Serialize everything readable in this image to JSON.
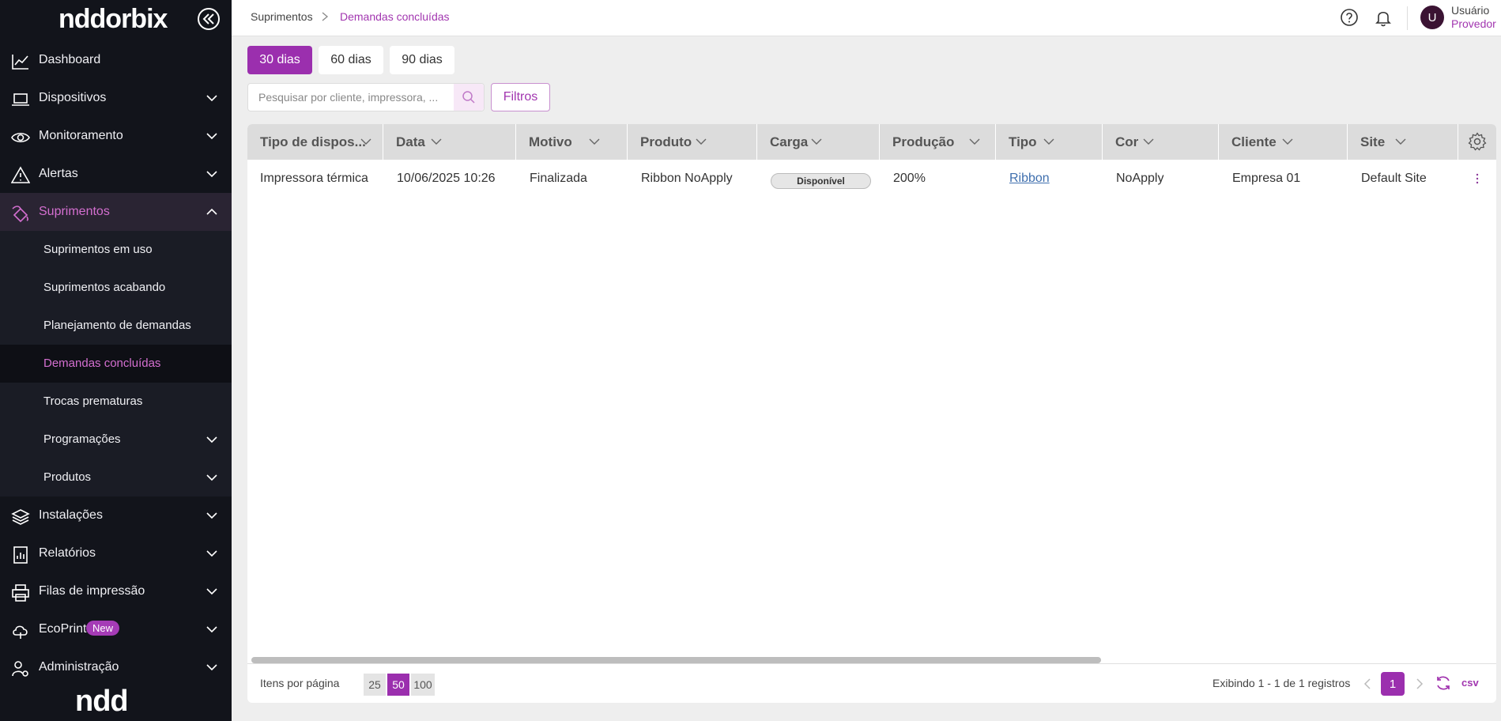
{
  "brand": {
    "name": "nddorbix",
    "footer": "ndd"
  },
  "sidebar": {
    "items": [
      {
        "label": "Dashboard"
      },
      {
        "label": "Dispositivos"
      },
      {
        "label": "Monitoramento"
      },
      {
        "label": "Alertas"
      },
      {
        "label": "Suprimentos"
      },
      {
        "label": "Instalações"
      },
      {
        "label": "Relatórios"
      },
      {
        "label": "Filas de impressão"
      },
      {
        "label": "EcoPrint",
        "badge": "New"
      },
      {
        "label": "Administração"
      }
    ],
    "sub_items": [
      {
        "label": "Suprimentos em uso"
      },
      {
        "label": "Suprimentos acabando"
      },
      {
        "label": "Planejamento de demandas"
      },
      {
        "label": "Demandas concluídas"
      },
      {
        "label": "Trocas prematuras"
      },
      {
        "label": "Programações"
      },
      {
        "label": "Produtos"
      }
    ]
  },
  "breadcrumb": {
    "parent": "Suprimentos",
    "current": "Demandas concluídas"
  },
  "user": {
    "initial": "U",
    "name": "Usuário",
    "role": "Provedor"
  },
  "periods": [
    "30 dias",
    "60 dias",
    "90 dias"
  ],
  "search": {
    "placeholder": "Pesquisar por cliente, impressora, ..."
  },
  "filters_label": "Filtros",
  "table": {
    "columns": [
      "Tipo de dispos...",
      "Data",
      "Motivo",
      "Produto",
      "Carga",
      "Produção",
      "Tipo",
      "Cor",
      "Cliente",
      "Site"
    ],
    "rows": [
      {
        "tipo_dispositivo": "Impressora térmica",
        "data": "10/06/2025 10:26",
        "motivo": "Finalizada",
        "produto": "Ribbon NoApply",
        "carga": "Disponível",
        "producao": "200%",
        "tipo": "Ribbon",
        "cor": "NoApply",
        "cliente": "Empresa 01",
        "site": "Default Site"
      }
    ]
  },
  "footer": {
    "per_page_label": "Itens por página",
    "per_page_options": [
      "25",
      "50",
      "100"
    ],
    "per_page_selected": "50",
    "showing": "Exibindo  1 - 1 de 1 registros",
    "current_page": "1",
    "export_label": "csv"
  },
  "colors": {
    "accent": "#9b2fae",
    "sidebar_bg": "#12141b",
    "active_text": "#d46fd0"
  },
  "icons": [
    "chart-line-icon",
    "laptop-icon",
    "eye-icon",
    "warning-icon",
    "supplies-icon",
    "layers-icon",
    "report-icon",
    "printer-icon",
    "cloud-icon",
    "admin-icon",
    "help-icon",
    "bell-icon",
    "search-icon",
    "settings-icon",
    "refresh-icon"
  ]
}
